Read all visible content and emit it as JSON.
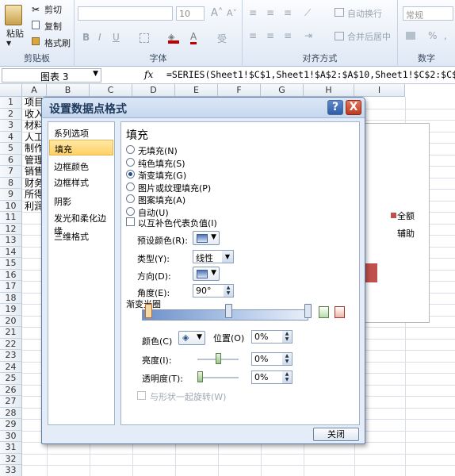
{
  "ribbon": {
    "clipboard": {
      "paste": "粘贴",
      "cut": "剪切",
      "copy": "复制",
      "format_painter": "格式刷",
      "label": "剪贴板"
    },
    "font": {
      "size": "10",
      "label": "字体",
      "bold": "B",
      "italic": "I",
      "underline": "U"
    },
    "alignment": {
      "wrap_text": "自动换行",
      "merge_center": "合并后居中",
      "label": "对齐方式"
    },
    "number": {
      "format": "常规",
      "percent": "%",
      "comma": ",",
      "label": "数字"
    }
  },
  "formula_bar": {
    "name_box": "图表 3",
    "fx": "fx",
    "formula": "=SERIES(Sheet1!$C$1,Sheet1!$A$2:$A$10,Sheet1!$C$2:$C$1"
  },
  "grid": {
    "columns": [
      "A",
      "B",
      "C",
      "D",
      "E",
      "F",
      "G",
      "H",
      "I"
    ],
    "rows": [
      "1",
      "2",
      "3",
      "4",
      "5",
      "6",
      "7",
      "8",
      "9",
      "10",
      "11",
      "12",
      "13",
      "14",
      "15",
      "16",
      "17",
      "18",
      "19",
      "20",
      "21",
      "22",
      "23",
      "24",
      "25",
      "26",
      "27",
      "28",
      "29",
      "30",
      "31",
      "32",
      "33"
    ],
    "cells_a": [
      "项目",
      "收入",
      "材料",
      "人工",
      "制作",
      "管理",
      "销售",
      "财务",
      "所得",
      "利润"
    ]
  },
  "chart": {
    "legend": [
      "全额",
      "辅助"
    ],
    "legend_color": "#c0504d"
  },
  "dialog": {
    "title": "设置数据点格式",
    "nav": [
      "系列选项",
      "填充",
      "边框颜色",
      "边框样式",
      "阴影",
      "发光和柔化边缘",
      "三维格式"
    ],
    "section": "填充",
    "fill_options": [
      "无填充(N)",
      "纯色填充(S)",
      "渐变填充(G)",
      "图片或纹理填充(P)",
      "图案填充(A)",
      "自动(U)"
    ],
    "invert_label": "以互补色代表负值(I)",
    "preset_label": "预设颜色(R):",
    "type_label": "类型(Y):",
    "type_value": "线性",
    "direction_label": "方向(D):",
    "angle_label": "角度(E):",
    "angle_value": "90°",
    "stops_label": "渐变光圈",
    "color_label": "颜色(C)",
    "position_label": "位置(O)",
    "position_value": "0%",
    "brightness_label": "亮度(I):",
    "brightness_value": "0%",
    "transparency_label": "透明度(T):",
    "transparency_value": "0%",
    "rotate_label": "与形状一起旋转(W)",
    "close": "关闭",
    "help": "?",
    "x": "X"
  }
}
